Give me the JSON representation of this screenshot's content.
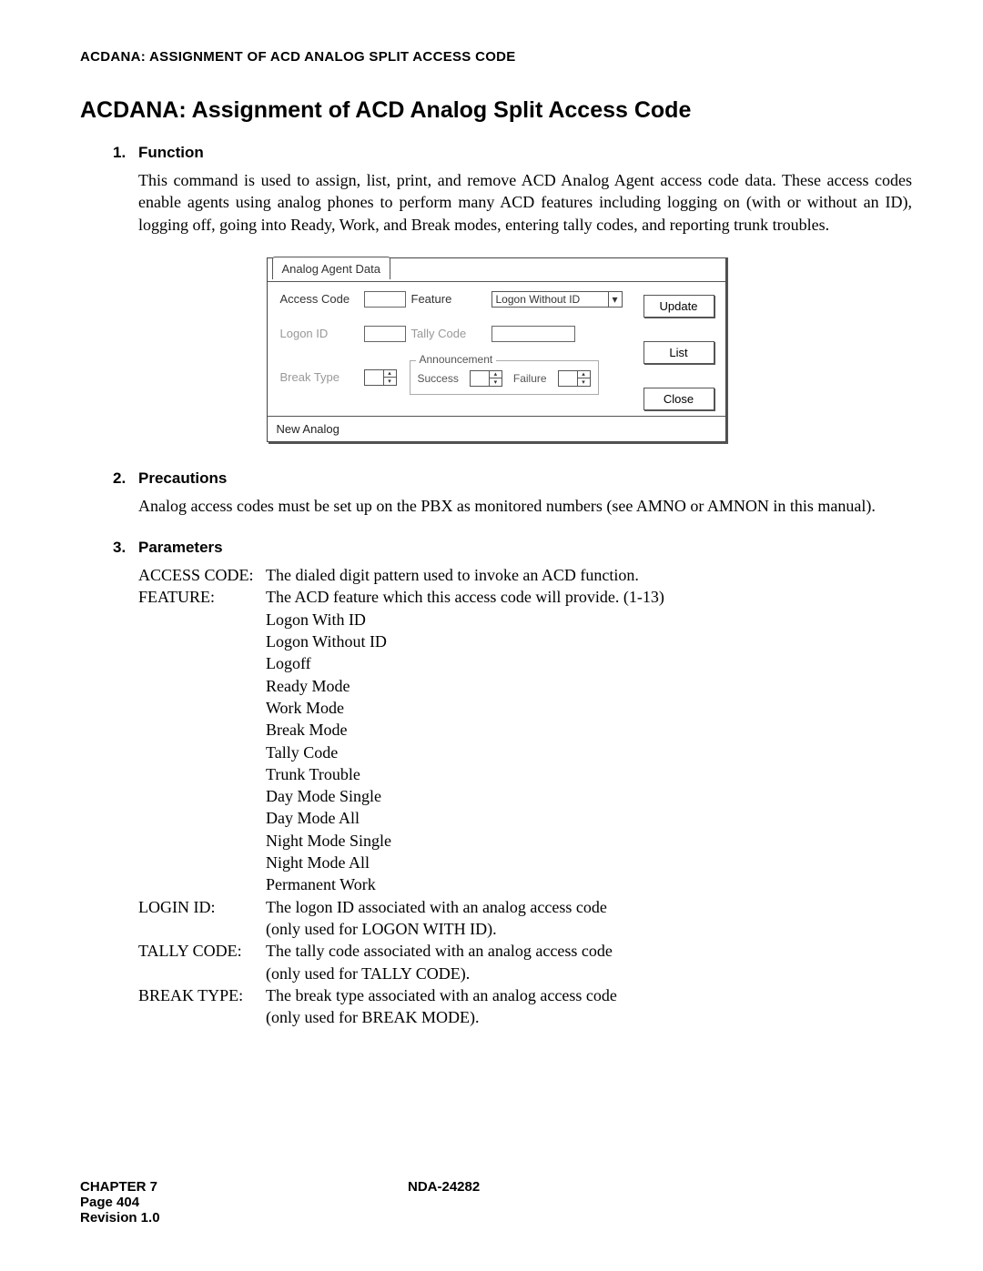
{
  "header": "ACDANA: ASSIGNMENT OF ACD ANALOG SPLIT ACCESS CODE",
  "title": "ACDANA: Assignment of ACD Analog Split Access Code",
  "sections": {
    "s1": {
      "num": "1.",
      "title": "Function",
      "body": "This command is used to assign, list, print, and remove ACD Analog Agent access code data. These access codes enable agents using analog phones to perform many ACD features including logging on (with or without an ID), logging off, going into Ready, Work, and Break modes, entering tally codes, and reporting trunk troubles."
    },
    "s2": {
      "num": "2.",
      "title": "Precautions",
      "body": "Analog access codes must be set up on the PBX as monitored numbers (see AMNO or AMNON in this manual)."
    },
    "s3": {
      "num": "3.",
      "title": "Parameters"
    }
  },
  "dialog": {
    "tab": "Analog Agent Data",
    "labels": {
      "access_code": "Access Code",
      "feature": "Feature",
      "feature_value": "Logon Without ID",
      "logon_id": "Logon ID",
      "tally_code": "Tally Code",
      "break_type": "Break Type",
      "announcement": "Announcement",
      "success": "Success",
      "failure": "Failure"
    },
    "buttons": {
      "update": "Update",
      "list": "List",
      "close": "Close"
    },
    "status": "New Analog"
  },
  "parameters": [
    {
      "name": "ACCESS CODE:",
      "lines": [
        "The dialed digit pattern used to invoke an ACD function."
      ]
    },
    {
      "name": "FEATURE:",
      "lines": [
        "The ACD feature which this access code will provide. (1-13)",
        "Logon With ID",
        "Logon Without ID",
        "Logoff",
        "Ready Mode",
        "Work Mode",
        "Break Mode",
        "Tally Code",
        "Trunk Trouble",
        "Day Mode Single",
        "Day Mode All",
        "Night Mode Single",
        "Night Mode All",
        "Permanent Work"
      ]
    },
    {
      "name": "LOGIN ID:",
      "lines": [
        "The logon ID associated with an analog access code",
        "(only used for LOGON WITH ID)."
      ]
    },
    {
      "name": "TALLY CODE:",
      "lines": [
        "The tally code associated with an analog access code",
        "(only used for TALLY CODE)."
      ]
    },
    {
      "name": "BREAK TYPE:",
      "lines": [
        "The break type associated with an analog access code",
        "(only used for BREAK MODE)."
      ]
    }
  ],
  "footer": {
    "chapter": "CHAPTER 7",
    "doc": "NDA-24282",
    "page": "Page 404",
    "rev": "Revision 1.0"
  }
}
